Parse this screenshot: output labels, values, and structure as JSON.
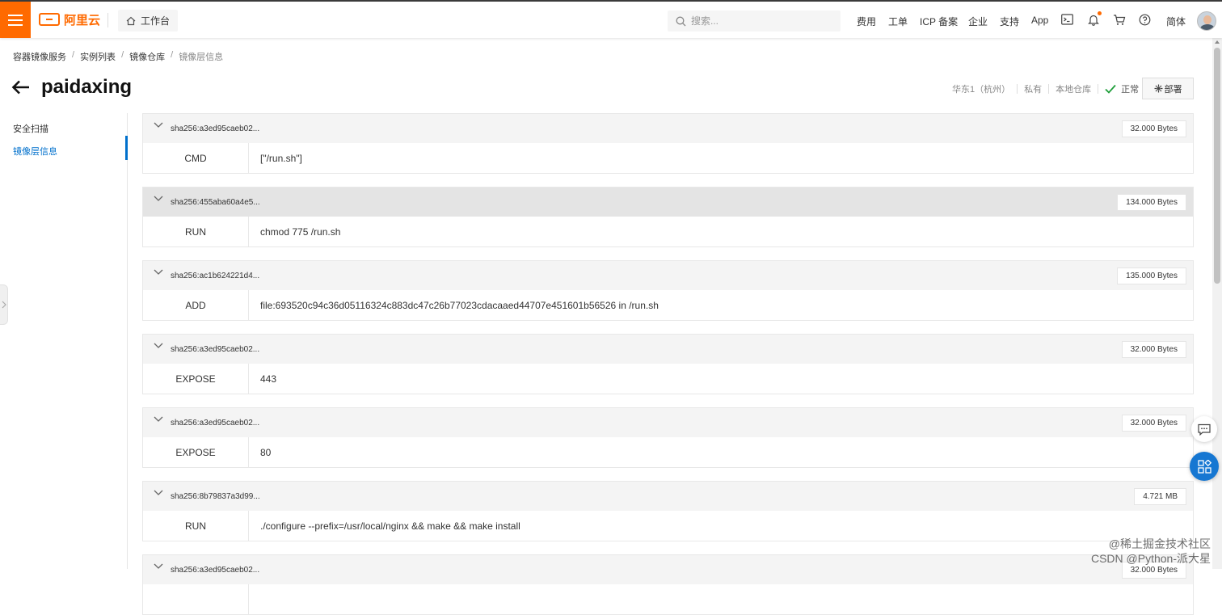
{
  "header": {
    "brand": "阿里云",
    "workbench_label": "工作台",
    "search_placeholder": "搜索...",
    "nav": [
      "费用",
      "工单",
      "ICP 备案",
      "企业",
      "支持",
      "App"
    ],
    "lang": "简体",
    "brand_color": "#ff6a00"
  },
  "breadcrumb": [
    "容器镜像服务",
    "实例列表",
    "镜像仓库",
    "镜像层信息"
  ],
  "page": {
    "title": "paidaxing",
    "region": "华东1（杭州）",
    "visibility": "私有",
    "source": "本地仓库",
    "status": "正常",
    "deploy_label": "部署"
  },
  "sidenav": {
    "items": [
      {
        "label": "安全扫描",
        "active": false
      },
      {
        "label": "镜像层信息",
        "active": true
      }
    ],
    "active_color": "#0070cc"
  },
  "layers": [
    {
      "digest": "sha256:a3ed95caeb02...",
      "size": "32.000 Bytes",
      "instruction": "CMD",
      "command": "[\"/run.sh\"]",
      "highlighted": false
    },
    {
      "digest": "sha256:455aba60a4e5...",
      "size": "134.000 Bytes",
      "instruction": "RUN",
      "command": "chmod 775 /run.sh",
      "highlighted": true
    },
    {
      "digest": "sha256:ac1b624221d4...",
      "size": "135.000 Bytes",
      "instruction": "ADD",
      "command": "file:693520c94c36d05116324c883dc47c26b77023cdacaaed44707e451601b56526 in /run.sh",
      "highlighted": false
    },
    {
      "digest": "sha256:a3ed95caeb02...",
      "size": "32.000 Bytes",
      "instruction": "EXPOSE",
      "command": "443",
      "highlighted": false
    },
    {
      "digest": "sha256:a3ed95caeb02...",
      "size": "32.000 Bytes",
      "instruction": "EXPOSE",
      "command": "80",
      "highlighted": false
    },
    {
      "digest": "sha256:8b79837a3d99...",
      "size": "4.721 MB",
      "instruction": "RUN",
      "command": "./configure --prefix=/usr/local/nginx && make && make install",
      "highlighted": false
    },
    {
      "digest": "sha256:a3ed95caeb02...",
      "size": "32.000 Bytes",
      "instruction": "",
      "command": "",
      "highlighted": false
    }
  ],
  "watermark": {
    "line1": "@稀土掘金技术社区",
    "line2": "CSDN @Python-派大星"
  }
}
